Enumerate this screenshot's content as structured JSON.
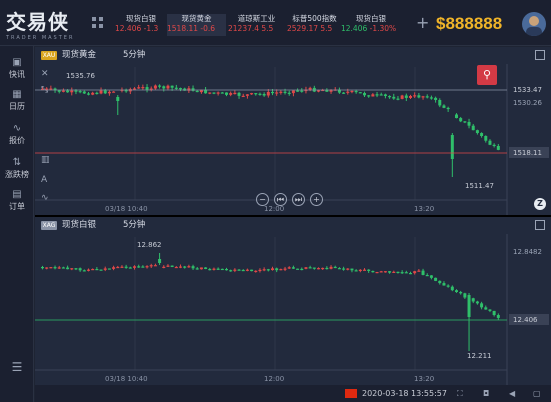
{
  "app": {
    "logo_cn": "交易侠",
    "logo_en": "TRADER MASTER",
    "balance": "$888888"
  },
  "tickers": [
    {
      "name": "现货白银",
      "price": "12.406",
      "change": "-1.3",
      "dir": "down"
    },
    {
      "name": "现货黄金",
      "price": "1518.11",
      "change": "-0.6",
      "dir": "down"
    },
    {
      "name": "道琼斯工业",
      "price": "21237.4",
      "change": "5.5",
      "dir": "up"
    },
    {
      "name": "标普500指数",
      "price": "2529.17",
      "change": "5.5",
      "dir": "up"
    },
    {
      "name": "现货白银",
      "price": "12.406",
      "change": "-1.30%",
      "dir": "down"
    }
  ],
  "sidebar": [
    {
      "label": "快讯",
      "icon": "news-icon"
    },
    {
      "label": "日历",
      "icon": "calendar-icon"
    },
    {
      "label": "报价",
      "icon": "quote-icon"
    },
    {
      "label": "涨跌榜",
      "icon": "ranking-icon"
    },
    {
      "label": "订单",
      "icon": "order-icon"
    }
  ],
  "chart1": {
    "badge": "XAU",
    "symbol": "现货黄金",
    "period": "5分钟",
    "high_label": "1535.76",
    "low_label": "1511.47",
    "price_levels": [
      "1533.47",
      "1530.26",
      "1518.11"
    ],
    "times": [
      "03/18 10:40",
      "12:00",
      "13:20"
    ],
    "colors": {
      "badge": "#d9a520",
      "up": "#e04848",
      "down": "#2fbf6a"
    }
  },
  "chart2": {
    "badge": "XAG",
    "symbol": "现货白银",
    "period": "5分钟",
    "high_label": "12.862",
    "low_label": "12.211",
    "price_levels": [
      "12.8482",
      "12.406"
    ],
    "times": [
      "03/18 10:40",
      "12:00",
      "13:20"
    ],
    "colors": {
      "badge": "#8a93a6"
    }
  },
  "status": {
    "datetime": "2020-03-18 13:55:57"
  }
}
